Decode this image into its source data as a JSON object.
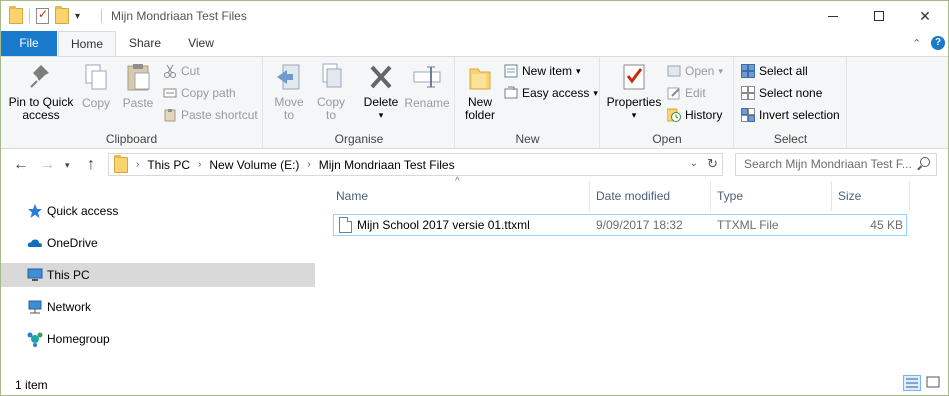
{
  "window": {
    "title": "Mijn Mondriaan Test Files",
    "controls": {
      "minimize": "minimize-icon",
      "maximize": "maximize-icon",
      "close": "close-icon"
    }
  },
  "tabs": {
    "file": "File",
    "home": "Home",
    "share": "Share",
    "view": "View",
    "active": "Home"
  },
  "ribbon": {
    "clipboard": {
      "label": "Clipboard",
      "pin": "Pin to Quick access",
      "pin_line1": "Pin to Quick",
      "pin_line2": "access",
      "copy": "Copy",
      "paste": "Paste",
      "cut": "Cut",
      "copy_path": "Copy path",
      "paste_shortcut": "Paste shortcut"
    },
    "organise": {
      "label": "Organise",
      "move_to_line1": "Move",
      "move_to_line2": "to",
      "copy_to_line1": "Copy",
      "copy_to_line2": "to",
      "delete": "Delete",
      "rename": "Rename"
    },
    "new": {
      "label": "New",
      "new_folder_line1": "New",
      "new_folder_line2": "folder",
      "new_item": "New item",
      "easy_access": "Easy access"
    },
    "open": {
      "label": "Open",
      "properties": "Properties",
      "open": "Open",
      "edit": "Edit",
      "history": "History"
    },
    "select": {
      "label": "Select",
      "select_all": "Select all",
      "select_none": "Select none",
      "invert": "Invert selection"
    }
  },
  "address": {
    "crumbs": [
      "This PC",
      "New Volume (E:)",
      "Mijn Mondriaan Test Files"
    ],
    "search_placeholder": "Search Mijn Mondriaan Test F..."
  },
  "navpane": {
    "items": [
      {
        "label": "Quick access",
        "icon": "star-icon"
      },
      {
        "label": "OneDrive",
        "icon": "cloud-icon"
      },
      {
        "label": "This PC",
        "icon": "computer-icon",
        "selected": true
      },
      {
        "label": "Network",
        "icon": "network-icon"
      },
      {
        "label": "Homegroup",
        "icon": "homegroup-icon"
      }
    ]
  },
  "filelist": {
    "columns": {
      "name": "Name",
      "date": "Date modified",
      "type": "Type",
      "size": "Size"
    },
    "rows": [
      {
        "name": "Mijn School 2017 versie 01.ttxml",
        "date": "9/09/2017 18:32",
        "type": "TTXML File",
        "size": "45 KB"
      }
    ]
  },
  "status": {
    "count": "1 item"
  },
  "colors": {
    "accent": "#1979ca",
    "selection_border": "#99d1ff",
    "nav_selected": "#d9d9d9"
  }
}
